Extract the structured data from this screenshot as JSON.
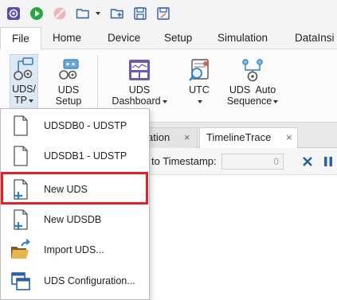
{
  "quick_access": {
    "icons": [
      "app-logo-icon",
      "run-icon",
      "stop-icon",
      "open-folder-icon",
      "new-folder-icon",
      "save-icon",
      "save-as-icon"
    ]
  },
  "menubar": {
    "items": [
      "File",
      "Home",
      "Device",
      "Setup",
      "Simulation",
      "DataInsi"
    ]
  },
  "ribbon": {
    "uds_tp": {
      "line1": "UDS/",
      "line2": "TP"
    },
    "uds_setup": {
      "line1": "UDS",
      "line2": "Setup"
    },
    "uds_dashboard": {
      "line1": "UDS",
      "line2": "Dashboard"
    },
    "utc": {
      "line1": "UTC"
    },
    "uds_auto_sequence": {
      "line1": "UDS  Auto",
      "line2": "Sequence"
    }
  },
  "tabs": {
    "partial_label": "ation",
    "timeline_label": "TimelineTrace",
    "close_glyph": "×"
  },
  "subbar": {
    "timestamp_label": "to Timestamp:",
    "timestamp_value": "0"
  },
  "dropdown": {
    "items": [
      {
        "label": "UDSDB0 - UDSTP"
      },
      {
        "label": "UDSDB1 - UDSTP"
      },
      {
        "label": "New UDS"
      },
      {
        "label": "New UDSDB"
      },
      {
        "label": "Import UDS..."
      },
      {
        "label": "UDS Configuration..."
      }
    ]
  },
  "colors": {
    "accent_blue": "#2f7fc1",
    "highlight_red": "#e0202a",
    "run_green": "#27a844",
    "stop_red": "#e05a5a",
    "close_blue": "#2d5fa8"
  }
}
